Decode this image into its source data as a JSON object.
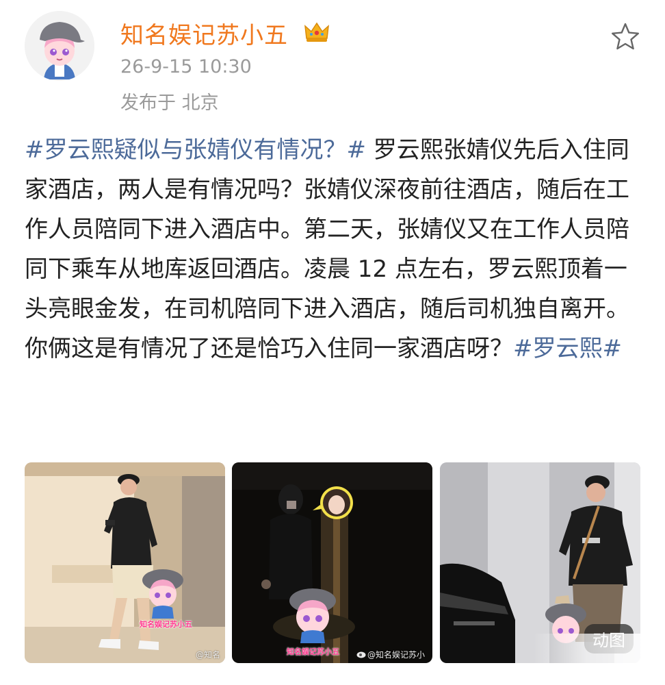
{
  "post": {
    "username": "知名娱记苏小五",
    "timestamp": "26-9-15 10:30",
    "location": "发布于 北京",
    "body": [
      {
        "text": "#罗云熙疑似与张婧仪有情况？#",
        "topic": true
      },
      {
        "text": " 罗云熙张婧仪先后入住同家酒店，两人是有情况吗？张婧仪深夜前往酒店，随后在工作人员陪同下进入酒店中。第二天，张婧仪又在工作人员陪同下乘车从地库返回酒店。凌晨 12 点左右，罗云熙顶着一头亮眼金发，在司机陪同下进入酒店，随后司机独自离开。你俩这是有情况了还是恰巧入住同一家酒店呀？",
        "topic": false
      },
      {
        "text": "#罗云熙#",
        "topic": true
      }
    ]
  },
  "images": [
    {
      "watermark": "@知名",
      "sticker_label": "知名娱记苏小五"
    },
    {
      "watermark": "@知名娱记苏小",
      "sticker_label": "知名娱记苏小五"
    },
    {
      "watermark": "",
      "sticker_label": "",
      "badge": "动图"
    }
  ],
  "icons": {
    "verified": "crown-icon",
    "favorite": "star-icon",
    "weibo": "weibo-icon"
  },
  "colors": {
    "username": "#f0781e",
    "topic": "#4c6a99",
    "meta": "#9a9a9a",
    "text": "#222222"
  }
}
